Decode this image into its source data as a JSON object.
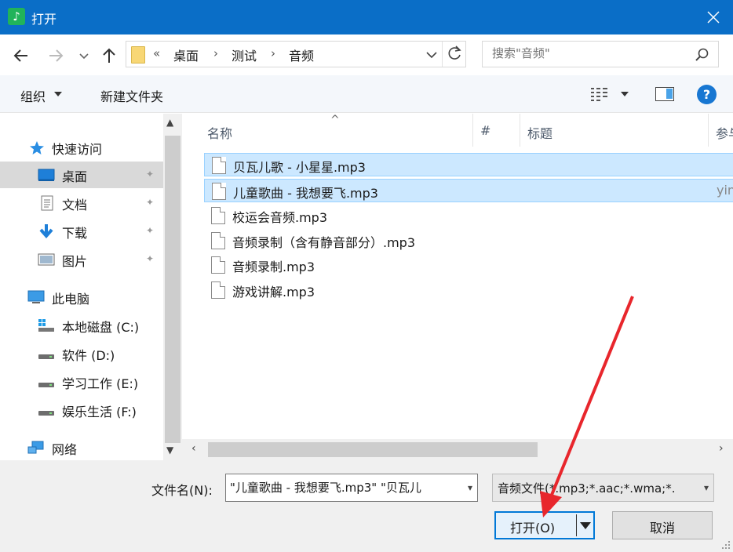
{
  "window": {
    "title": "打开",
    "app_icon": "music-note-icon",
    "close_icon": "close-icon"
  },
  "nav": {
    "back_icon": "arrow-left-icon",
    "forward_icon": "arrow-right-icon",
    "history_icon": "chevron-down-icon",
    "up_icon": "arrow-up-icon",
    "breadcrumb_prefix": "«",
    "breadcrumb": [
      "桌面",
      "测试",
      "音频"
    ],
    "breadcrumb_separator": "›",
    "refresh_icon": "refresh-icon",
    "search_placeholder": "搜索\"音频\""
  },
  "toolbar": {
    "organize": "组织",
    "new_folder": "新建文件夹",
    "view_icon": "view-details-icon",
    "preview_icon": "preview-pane-icon",
    "help": "?"
  },
  "sidebar": {
    "items": [
      {
        "label": "快速访问",
        "icon": "star-icon",
        "pinned": false,
        "selected": false,
        "indent": 1
      },
      {
        "label": "桌面",
        "icon": "desktop-icon",
        "pinned": true,
        "selected": true,
        "indent": 2
      },
      {
        "label": "文档",
        "icon": "document-icon",
        "pinned": true,
        "selected": false,
        "indent": 2
      },
      {
        "label": "下载",
        "icon": "download-icon",
        "pinned": true,
        "selected": false,
        "indent": 2
      },
      {
        "label": "图片",
        "icon": "pictures-icon",
        "pinned": true,
        "selected": false,
        "indent": 2
      },
      {
        "label": "此电脑",
        "icon": "computer-icon",
        "pinned": false,
        "selected": false,
        "indent": 1
      },
      {
        "label": "本地磁盘 (C:)",
        "icon": "system-drive-icon",
        "pinned": false,
        "selected": false,
        "indent": 2
      },
      {
        "label": "软件 (D:)",
        "icon": "drive-icon",
        "pinned": false,
        "selected": false,
        "indent": 2
      },
      {
        "label": "学习工作 (E:)",
        "icon": "drive-icon",
        "pinned": false,
        "selected": false,
        "indent": 2
      },
      {
        "label": "娱乐生活 (F:)",
        "icon": "drive-icon",
        "pinned": false,
        "selected": false,
        "indent": 2
      },
      {
        "label": "网络",
        "icon": "network-icon",
        "pinned": false,
        "selected": false,
        "indent": 1
      }
    ],
    "pin_glyph": "📌"
  },
  "columns": [
    "名称",
    "#",
    "标题",
    "参与"
  ],
  "files": [
    {
      "name": "贝瓦儿歌 - 小星星.mp3",
      "selected": true,
      "extra": ""
    },
    {
      "name": "儿童歌曲 - 我想要飞.mp3",
      "selected": true,
      "extra": "yin"
    },
    {
      "name": "校运会音频.mp3",
      "selected": false,
      "extra": ""
    },
    {
      "name": "音频录制（含有静音部分）.mp3",
      "selected": false,
      "extra": ""
    },
    {
      "name": "音频录制.mp3",
      "selected": false,
      "extra": ""
    },
    {
      "name": "游戏讲解.mp3",
      "selected": false,
      "extra": ""
    }
  ],
  "bottom": {
    "filename_label": "文件名(N):",
    "filename_value": "\"儿童歌曲 - 我想要飞.mp3\" \"贝瓦儿",
    "filetype_value": "音频文件(*.mp3;*.aac;*.wma;*.",
    "open_label": "打开(O)",
    "cancel_label": "取消"
  },
  "colors": {
    "titlebar": "#0a6ec7",
    "selection": "#cce8ff",
    "annotation_arrow": "#e8262c"
  }
}
